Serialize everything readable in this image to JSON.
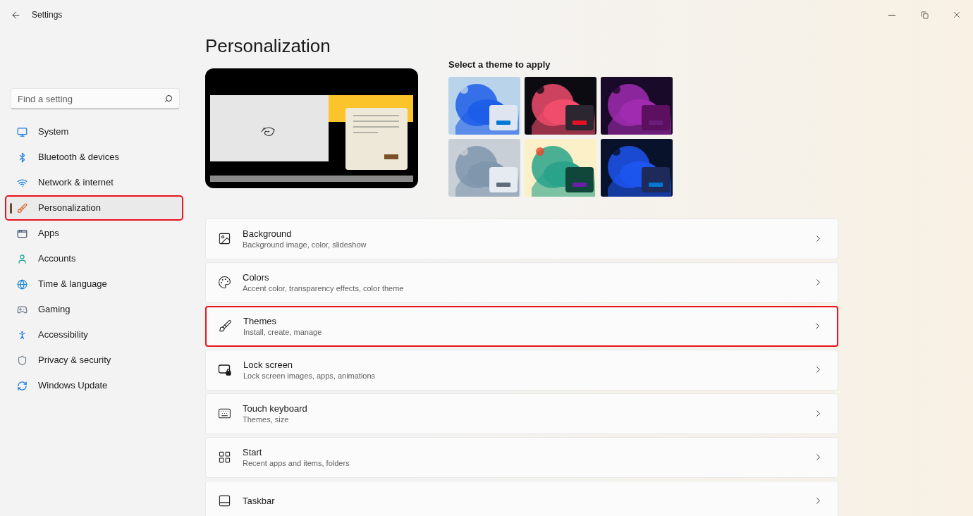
{
  "window": {
    "title": "Settings"
  },
  "search": {
    "placeholder": "Find a setting"
  },
  "sidebar": {
    "items": [
      {
        "label": "System",
        "selected": false,
        "highlighted": false
      },
      {
        "label": "Bluetooth & devices",
        "selected": false,
        "highlighted": false
      },
      {
        "label": "Network & internet",
        "selected": false,
        "highlighted": false
      },
      {
        "label": "Personalization",
        "selected": true,
        "highlighted": true
      },
      {
        "label": "Apps",
        "selected": false,
        "highlighted": false
      },
      {
        "label": "Accounts",
        "selected": false,
        "highlighted": false
      },
      {
        "label": "Time & language",
        "selected": false,
        "highlighted": false
      },
      {
        "label": "Gaming",
        "selected": false,
        "highlighted": false
      },
      {
        "label": "Accessibility",
        "selected": false,
        "highlighted": false
      },
      {
        "label": "Privacy & security",
        "selected": false,
        "highlighted": false
      },
      {
        "label": "Windows Update",
        "selected": false,
        "highlighted": false
      }
    ]
  },
  "page": {
    "title": "Personalization"
  },
  "themes": {
    "heading": "Select a theme to apply",
    "items": [
      {
        "color": "#0078d4"
      },
      {
        "color": "#e81123"
      },
      {
        "color": "#6b1d7a"
      },
      {
        "color": "#5d6b7b"
      },
      {
        "color": "#6b1fa8"
      },
      {
        "color": "#0078d4"
      }
    ]
  },
  "cards": [
    {
      "title": "Background",
      "subtitle": "Background image, color, slideshow",
      "highlighted": false
    },
    {
      "title": "Colors",
      "subtitle": "Accent color, transparency effects, color theme",
      "highlighted": false
    },
    {
      "title": "Themes",
      "subtitle": "Install, create, manage",
      "highlighted": true
    },
    {
      "title": "Lock screen",
      "subtitle": "Lock screen images, apps, animations",
      "highlighted": false
    },
    {
      "title": "Touch keyboard",
      "subtitle": "Themes, size",
      "highlighted": false
    },
    {
      "title": "Start",
      "subtitle": "Recent apps and items, folders",
      "highlighted": false
    },
    {
      "title": "Taskbar",
      "highlighted": false
    }
  ]
}
